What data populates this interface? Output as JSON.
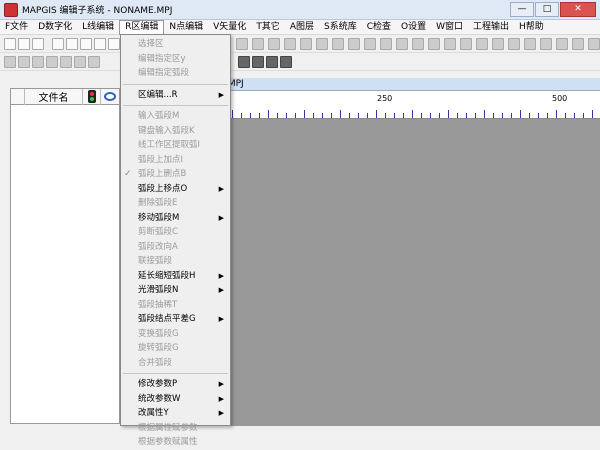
{
  "window": {
    "title": "MAPGIS 编辑子系统 - NONAME.MPJ",
    "buttons": [
      "—",
      "□",
      "✕"
    ]
  },
  "menubar": [
    {
      "label": "F文件",
      "active": false
    },
    {
      "label": "D数字化",
      "active": false
    },
    {
      "label": "L线编辑",
      "active": false
    },
    {
      "label": "R区编辑",
      "active": true
    },
    {
      "label": "N点编辑",
      "active": false
    },
    {
      "label": "V矢量化",
      "active": false
    },
    {
      "label": "T其它",
      "active": false
    },
    {
      "label": "A图层",
      "active": false
    },
    {
      "label": "S系统库",
      "active": false
    },
    {
      "label": "C检查",
      "active": false
    },
    {
      "label": "O设置",
      "active": false
    },
    {
      "label": "W窗口",
      "active": false
    },
    {
      "label": "工程输出",
      "active": false
    },
    {
      "label": "H帮助",
      "active": false
    }
  ],
  "legend": {
    "col_name": "文件名",
    "traffic_icon": "traffic-light-icon",
    "eye_icon": "eye-icon"
  },
  "map": {
    "title_suffix": ".MPJ",
    "ruler_labels": [
      "250",
      "500"
    ]
  },
  "region_menu": {
    "items": [
      {
        "label": "选择区",
        "enabled": false,
        "submenu": false
      },
      {
        "label": "编辑指定区y",
        "enabled": false,
        "submenu": false
      },
      {
        "label": "编辑指定弧段",
        "enabled": false,
        "submenu": false
      },
      {
        "sep": true
      },
      {
        "label": "区编辑...R",
        "enabled": true,
        "submenu": true
      },
      {
        "sep": true
      },
      {
        "label": "输入弧段M",
        "enabled": false,
        "submenu": false
      },
      {
        "label": "键盘输入弧段K",
        "enabled": false,
        "submenu": false
      },
      {
        "label": "线工作区提取弧I",
        "enabled": false,
        "submenu": false
      },
      {
        "label": "弧段上加点I",
        "enabled": false,
        "submenu": false
      },
      {
        "label": "弧段上删点B",
        "enabled": false,
        "submenu": false,
        "check": true
      },
      {
        "label": "弧段上移点O",
        "enabled": true,
        "submenu": true
      },
      {
        "label": "删除弧段E",
        "enabled": false,
        "submenu": false
      },
      {
        "label": "移动弧段M",
        "enabled": true,
        "submenu": true
      },
      {
        "label": "剪断弧段C",
        "enabled": false,
        "submenu": false
      },
      {
        "label": "弧段改向A",
        "enabled": false,
        "submenu": false
      },
      {
        "label": "联接弧段",
        "enabled": false,
        "submenu": false
      },
      {
        "label": "延长缩短弧段H",
        "enabled": true,
        "submenu": true
      },
      {
        "label": "光滑弧段N",
        "enabled": true,
        "submenu": true
      },
      {
        "label": "弧段抽稀T",
        "enabled": false,
        "submenu": false
      },
      {
        "label": "弧段结点平差G",
        "enabled": true,
        "submenu": true
      },
      {
        "label": "变换弧段G",
        "enabled": false,
        "submenu": false
      },
      {
        "label": "旋转弧段G",
        "enabled": false,
        "submenu": false
      },
      {
        "label": "合并弧段",
        "enabled": false,
        "submenu": false
      },
      {
        "sep": true
      },
      {
        "label": "修改参数P",
        "enabled": true,
        "submenu": true
      },
      {
        "label": "统改参数W",
        "enabled": true,
        "submenu": true
      },
      {
        "label": "改属性Y",
        "enabled": true,
        "submenu": true
      },
      {
        "label": "根据属性赋参数",
        "enabled": false,
        "submenu": false
      },
      {
        "label": "根据参数赋属性",
        "enabled": false,
        "submenu": false
      }
    ]
  }
}
